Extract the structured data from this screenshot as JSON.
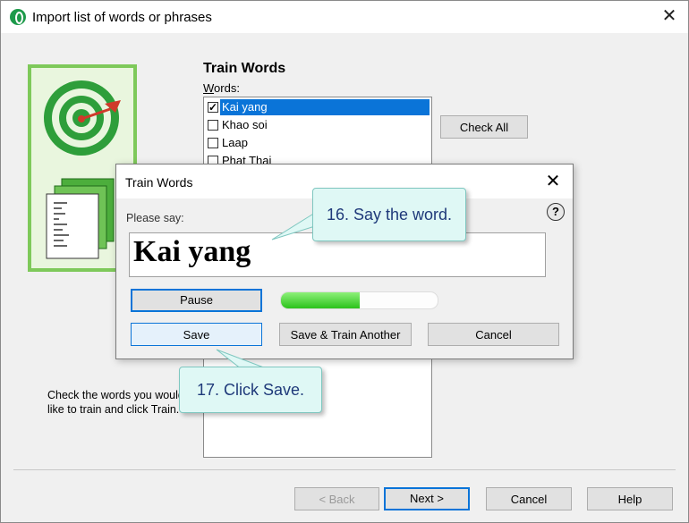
{
  "window": {
    "title": "Import list of words or phrases",
    "close_glyph": "✕"
  },
  "main": {
    "heading": "Train Words",
    "words_label": "Words:",
    "list": [
      {
        "label": "Kai yang",
        "checked": true,
        "selected": true
      },
      {
        "label": "Khao soi",
        "checked": false,
        "selected": false
      },
      {
        "label": "Laap",
        "checked": false,
        "selected": false
      },
      {
        "label": "Phat Thai",
        "checked": false,
        "selected": false
      }
    ],
    "check_all": "Check All",
    "hint": "Check the words you would like to train and click Train."
  },
  "footer": {
    "back": "< Back",
    "next": "Next >",
    "cancel": "Cancel",
    "help": "Help"
  },
  "dialog": {
    "title": "Train Words",
    "close_glyph": "✕",
    "prompt_label": "Please say:",
    "word": "Kai yang",
    "help_glyph": "?",
    "pause": "Pause",
    "save": "Save",
    "save_train_another": "Save & Train Another",
    "cancel": "Cancel",
    "level": 0.5
  },
  "callouts": {
    "step16": "16. Say the word.",
    "step17": "17. Click Save."
  },
  "colors": {
    "accent": "#0a74d8",
    "logo_green": "#7ec95a",
    "target_green": "#2e9e3a",
    "callout_bg": "#dff8f5",
    "callout_text": "#1f3a7a"
  }
}
